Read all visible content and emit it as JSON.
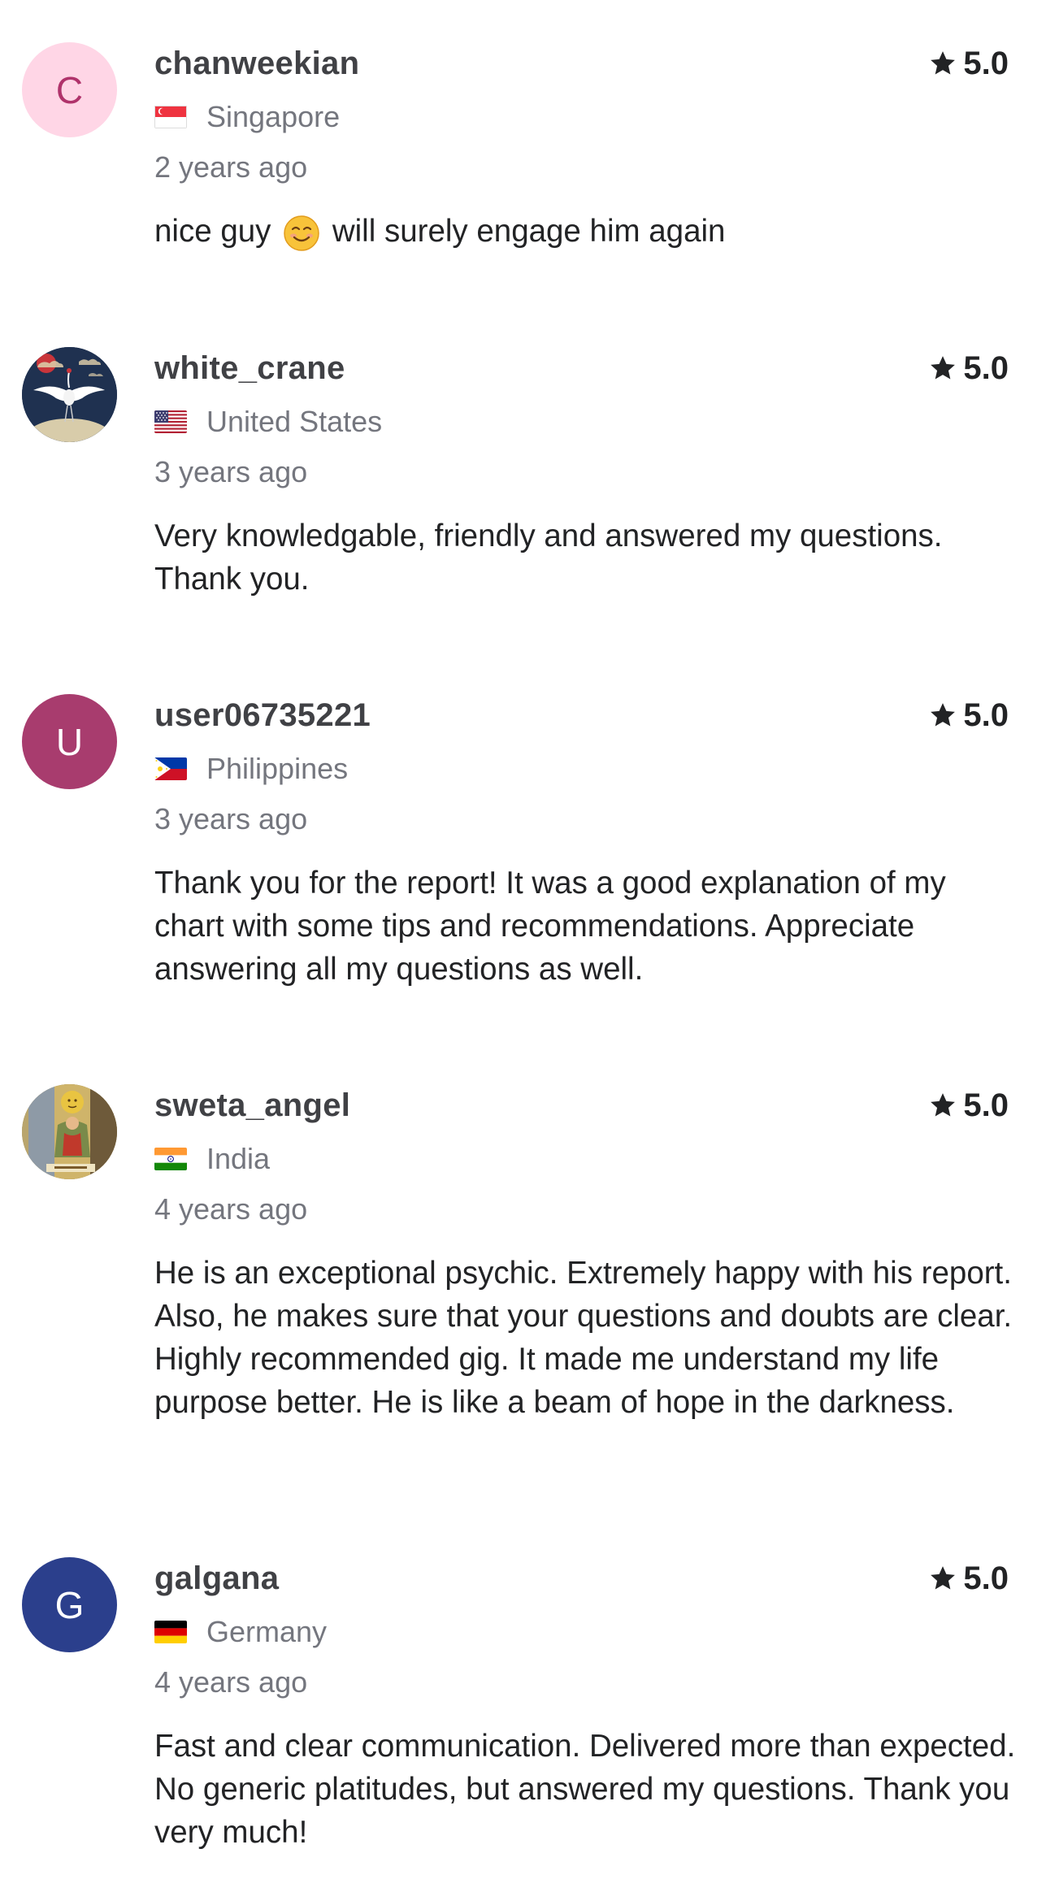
{
  "reviews": [
    {
      "username": "chanweekian",
      "avatar_initial": "C",
      "avatar_bg": "#ffd6e6",
      "avatar_fg": "#b0336b",
      "country": "Singapore",
      "flag_icon": "flag-singapore-icon",
      "time": "2 years ago",
      "rating": "5.0",
      "text_before_emoji": "nice guy",
      "emoji_icon": "smiling-face-emoji",
      "text_after_emoji": "will surely engage him again"
    },
    {
      "username": "white_crane",
      "avatar_image": "crane-illustration-avatar",
      "country": "United States",
      "flag_icon": "flag-united-states-icon",
      "time": "3 years ago",
      "rating": "5.0",
      "text": "Very knowledgable, friendly and answered my questions. Thank you."
    },
    {
      "username": "user06735221",
      "avatar_initial": "U",
      "avatar_bg": "#a83c6e",
      "avatar_fg": "#ffffff",
      "country": "Philippines",
      "flag_icon": "flag-philippines-icon",
      "time": "3 years ago",
      "rating": "5.0",
      "text": "Thank you for the report! It was a good explanation of my chart with some tips and recommendations. Appreciate answering all my questions as well."
    },
    {
      "username": "sweta_angel",
      "avatar_image": "tarot-sun-card-avatar",
      "country": "India",
      "flag_icon": "flag-india-icon",
      "time": "4 years ago",
      "rating": "5.0",
      "text": "He is an exceptional psychic. Extremely happy with his report. Also, he makes sure that your questions and doubts are clear. Highly recommended gig. It made me understand my life purpose better. He is like a beam of hope in the darkness."
    },
    {
      "username": "galgana",
      "avatar_initial": "G",
      "avatar_bg": "#2b3f8c",
      "avatar_fg": "#ffffff",
      "country": "Germany",
      "flag_icon": "flag-germany-icon",
      "time": "4 years ago",
      "rating": "5.0",
      "text": "Fast and clear communication. Delivered more than expected. No generic platitudes, but answered my questions. Thank you very much!"
    }
  ]
}
